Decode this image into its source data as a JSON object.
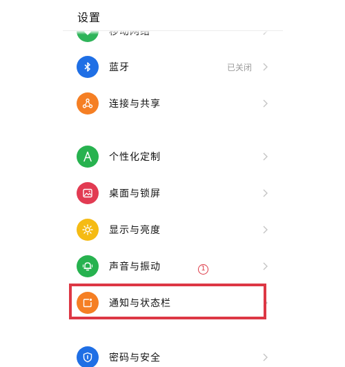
{
  "header": {
    "title": "设置"
  },
  "rows": [
    {
      "label": "移动网络",
      "value": "",
      "icon": "mobile-network-icon",
      "color": "#2fb45a"
    },
    {
      "label": "蓝牙",
      "value": "已关闭",
      "icon": "bluetooth-icon",
      "color": "#1f6fe5"
    },
    {
      "label": "连接与共享",
      "value": "",
      "icon": "share-icon",
      "color": "#f57f24"
    },
    {
      "label": "个性化定制",
      "value": "",
      "icon": "personalization-icon",
      "color": "#27b24f"
    },
    {
      "label": "桌面与锁屏",
      "value": "",
      "icon": "wallpaper-icon",
      "color": "#e23b52"
    },
    {
      "label": "显示与亮度",
      "value": "",
      "icon": "brightness-icon",
      "color": "#f5bb14"
    },
    {
      "label": "声音与振动",
      "value": "",
      "icon": "bell-icon",
      "color": "#27b24f"
    },
    {
      "label": "通知与状态栏",
      "value": "",
      "icon": "notification-icon",
      "color": "#f57f24"
    },
    {
      "label": "密码与安全",
      "value": "",
      "icon": "shield-icon",
      "color": "#1f6fe5"
    }
  ],
  "annotation": {
    "marker": "1"
  }
}
